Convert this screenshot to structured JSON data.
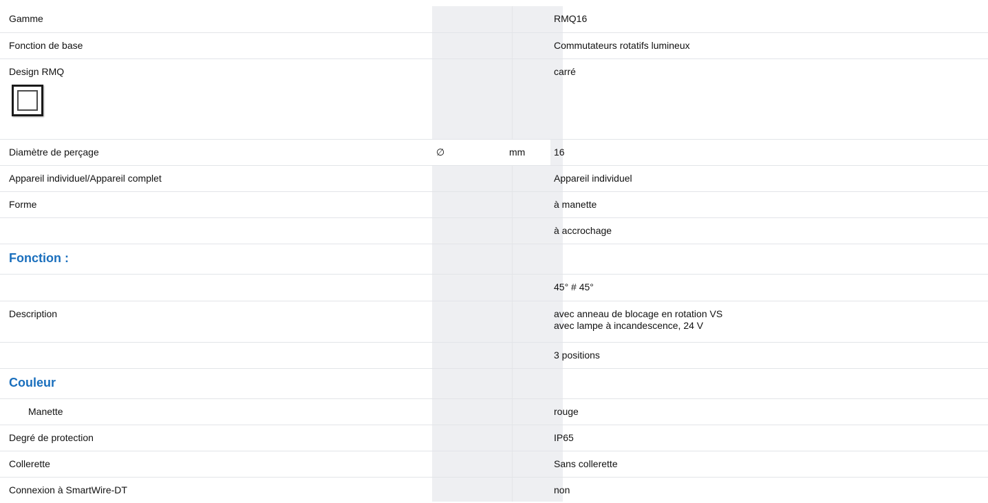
{
  "rows": [
    {
      "label": "Gamme",
      "symbol": "",
      "unit": "",
      "value": "RMQ16"
    },
    {
      "label": "Fonction de base",
      "symbol": "",
      "unit": "",
      "value": "Commutateurs rotatifs lumineux"
    },
    {
      "label": "Design RMQ",
      "symbol": "",
      "unit": "",
      "value": "carré",
      "icon": "square-design-icon"
    },
    {
      "label": "Diamètre de perçage",
      "symbol": "∅",
      "unit": "mm",
      "value": "16"
    },
    {
      "label": "Appareil individuel/Appareil complet",
      "symbol": "",
      "unit": "",
      "value": "Appareil individuel"
    },
    {
      "label": "Forme",
      "symbol": "",
      "unit": "",
      "value": "à manette"
    },
    {
      "label": "",
      "symbol": "",
      "unit": "",
      "value": "à accrochage"
    },
    {
      "label": "Fonction :",
      "section": true
    },
    {
      "label": "",
      "symbol": "",
      "unit": "",
      "value": "45° # 45°"
    },
    {
      "label": "Description",
      "symbol": "",
      "unit": "",
      "value_lines": [
        "avec anneau de blocage en rotation VS",
        "avec lampe à incandescence, 24 V"
      ]
    },
    {
      "label": "",
      "symbol": "",
      "unit": "",
      "value": "3 positions"
    },
    {
      "label": "Couleur",
      "section": true
    },
    {
      "label": "Manette",
      "indent": true,
      "symbol": "",
      "unit": "",
      "value": "rouge"
    },
    {
      "label": "Degré de protection",
      "symbol": "",
      "unit": "",
      "value": "IP65"
    },
    {
      "label": "Collerette",
      "symbol": "",
      "unit": "",
      "value": "Sans collerette"
    },
    {
      "label": "Connexion à SmartWire-DT",
      "symbol": "",
      "unit": "",
      "value": "non"
    }
  ],
  "colors": {
    "section_heading": "#1a6fbd",
    "column_shade": "#eeeff2",
    "row_border": "#e2e4e8"
  }
}
